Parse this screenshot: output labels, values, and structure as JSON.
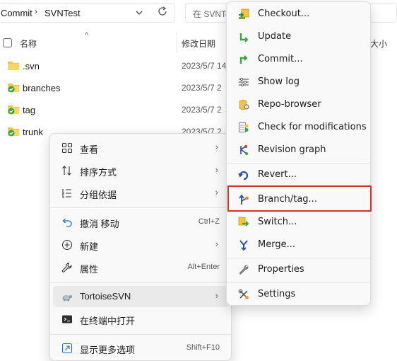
{
  "address": {
    "crumb1": "Commit",
    "crumb2": "SVNTest"
  },
  "search": {
    "placeholder": "在 SVNTest 中搜索"
  },
  "columns": {
    "name": "名称",
    "date": "修改日期",
    "size": "大小"
  },
  "files": [
    {
      "name": ".svn",
      "date": "2023/5/7 14:"
    },
    {
      "name": "branches",
      "date": "2023/5/7 2"
    },
    {
      "name": "tag",
      "date": "2023/5/7 2"
    },
    {
      "name": "trunk",
      "date": "2023/5/7 2"
    }
  ],
  "context_menu": {
    "view": "查看",
    "sort": "排序方式",
    "group": "分组依据",
    "undo": "撤消 移动",
    "undo_key": "Ctrl+Z",
    "new": "新建",
    "properties": "属性",
    "properties_key": "Alt+Enter",
    "tortoise": "TortoiseSVN",
    "terminal": "在终端中打开",
    "more": "显示更多选项",
    "more_key": "Shift+F10"
  },
  "svn_menu": {
    "checkout": "Checkout...",
    "update": "Update",
    "commit": "Commit...",
    "showlog": "Show log",
    "repo": "Repo-browser",
    "check": "Check for modifications",
    "revgraph": "Revision graph",
    "revert": "Revert...",
    "branch": "Branch/tag...",
    "switch": "Switch...",
    "merge": "Merge...",
    "properties": "Properties",
    "settings": "Settings"
  },
  "colors": {
    "highlight_border": "#d9302e",
    "svn_green": "#3aa53a",
    "folder_yellow": "#f6c343"
  }
}
